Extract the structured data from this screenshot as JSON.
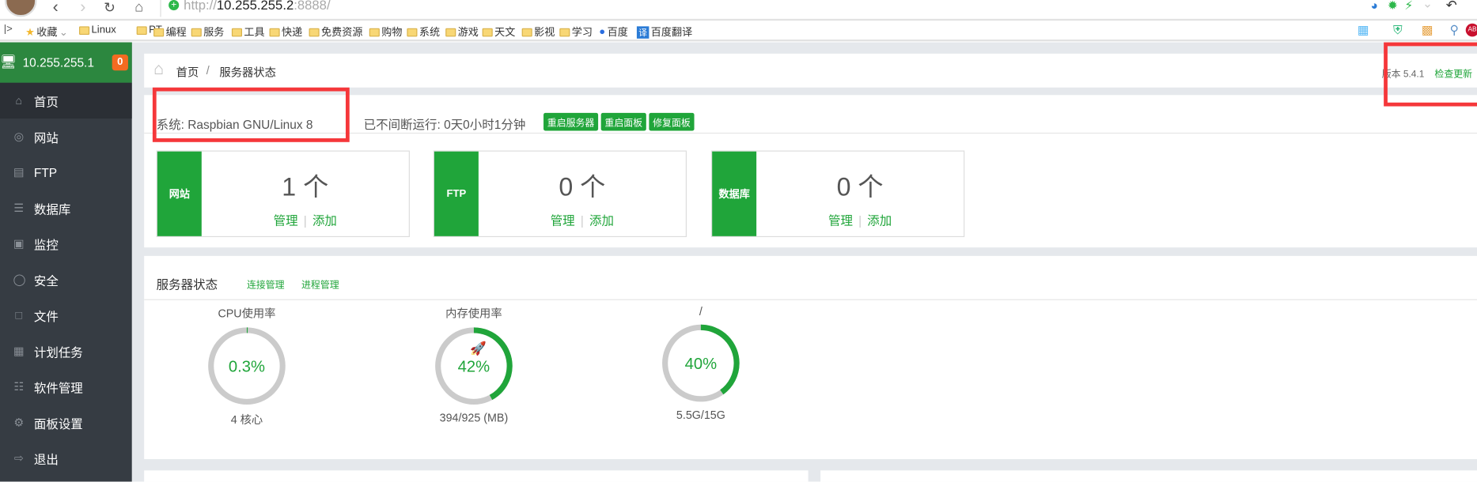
{
  "browser": {
    "url_host": "10.255.255.2",
    "url_prefix": "http://",
    "url_suffix": ":8888/",
    "bookmarks": [
      "收藏",
      "Linux",
      "PT",
      "编程",
      "服务",
      "工具",
      "快递",
      "免费资源",
      "购物",
      "系统",
      "游戏",
      "天文",
      "影视",
      "学习",
      "百度",
      "百度翻译"
    ]
  },
  "sidebar": {
    "host": "10.255.255.1",
    "badge": "0",
    "items": [
      {
        "label": "首页",
        "icon": "home-icon"
      },
      {
        "label": "网站",
        "icon": "globe-icon"
      },
      {
        "label": "FTP",
        "icon": "ftp-icon"
      },
      {
        "label": "数据库",
        "icon": "database-icon"
      },
      {
        "label": "监控",
        "icon": "monitor-icon"
      },
      {
        "label": "安全",
        "icon": "shield-icon"
      },
      {
        "label": "文件",
        "icon": "folder-icon"
      },
      {
        "label": "计划任务",
        "icon": "calendar-icon"
      },
      {
        "label": "软件管理",
        "icon": "grid-icon"
      },
      {
        "label": "面板设置",
        "icon": "gear-icon"
      },
      {
        "label": "退出",
        "icon": "logout-icon"
      }
    ]
  },
  "breadcrumb": {
    "home": "首页",
    "sep": "/",
    "current": "服务器状态",
    "version": "版本 5.4.1",
    "check_update": "检查更新"
  },
  "system": {
    "os": "系统: Raspbian GNU/Linux 8",
    "uptime": "已不间断运行: 0天0小时1分钟",
    "buttons": [
      "重启服务器",
      "重启面板",
      "修复面板"
    ]
  },
  "cards": [
    {
      "label": "网站",
      "count": "1 个",
      "manage": "管理",
      "add": "添加"
    },
    {
      "label": "FTP",
      "count": "0 个",
      "manage": "管理",
      "add": "添加"
    },
    {
      "label": "数据库",
      "count": "0 个",
      "manage": "管理",
      "add": "添加"
    }
  ],
  "status": {
    "title": "服务器状态",
    "links": [
      "连接管理",
      "进程管理"
    ],
    "gauges": [
      {
        "title": "CPU使用率",
        "value": "0.3%",
        "percent": 0.3,
        "footer": "4 核心"
      },
      {
        "title": "内存使用率",
        "value": "42%",
        "percent": 42,
        "footer": "394/925 (MB)"
      },
      {
        "title": "/",
        "value": "40%",
        "percent": 40,
        "footer": "5.5G/15G"
      }
    ]
  },
  "colors": {
    "accent": "#20a53a",
    "sidebar": "#363c43",
    "highlight": "#f5373a"
  }
}
